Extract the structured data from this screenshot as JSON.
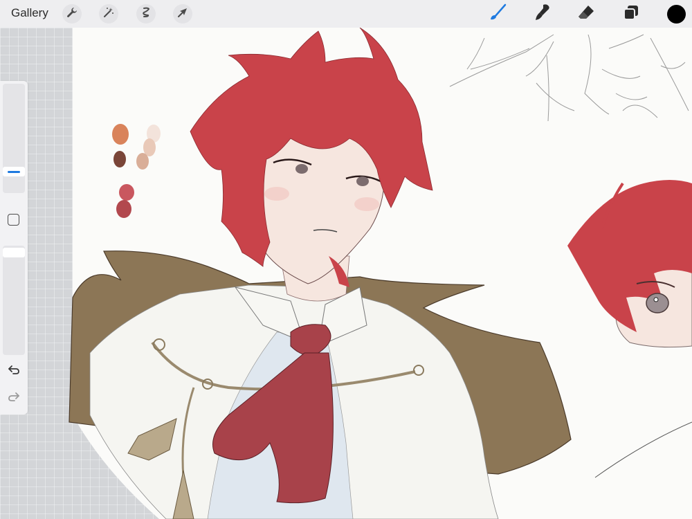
{
  "app": {
    "gallery_label": "Gallery"
  },
  "toolbar_left": [
    {
      "icon": "wrench-icon",
      "name": "actions"
    },
    {
      "icon": "magic-wand-icon",
      "name": "adjustments"
    },
    {
      "icon": "selection-icon",
      "name": "selection"
    },
    {
      "icon": "arrow-cursor-icon",
      "name": "transform"
    }
  ],
  "toolbar_right": [
    {
      "icon": "brush-icon",
      "name": "paint",
      "active": true
    },
    {
      "icon": "smudge-icon",
      "name": "smudge",
      "active": false
    },
    {
      "icon": "eraser-icon",
      "name": "erase",
      "active": false
    },
    {
      "icon": "layers-icon",
      "name": "layers",
      "active": false
    }
  ],
  "current_color": "#000000",
  "accent_color": "#1f7ae0",
  "sidebar": {
    "brush_size_level": 0.78,
    "opacity_level": 0.05,
    "undo_icon": "undo-icon",
    "redo_icon": "redo-icon",
    "modify_icon": "square-icon"
  },
  "palette_swatches": [
    "#d9835b",
    "#7a4538",
    "#f0d9cc",
    "#d9ae98",
    "#c9575f",
    "#b2484e"
  ],
  "artwork_colors": {
    "canvas": "#fbfbf9",
    "hair": "#c9434a",
    "skin": "#f6e6df",
    "cape": "#8c7656",
    "shirt": "#f5f5f1",
    "undershirt": "#dfe7ef",
    "cravat": "#a8424a",
    "rope": "#9a8a6e"
  }
}
